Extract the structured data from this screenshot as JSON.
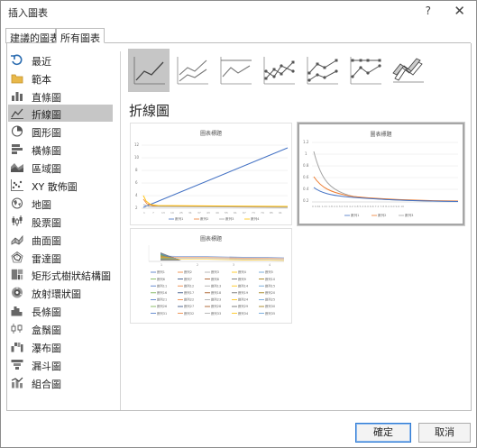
{
  "dialog": {
    "title": "插入圖表",
    "help": "?",
    "close": "✕"
  },
  "tabs": [
    {
      "label": "建議的圖表",
      "active": false
    },
    {
      "label": "所有圖表",
      "active": true
    }
  ],
  "sidebar": {
    "items": [
      {
        "label": "最近",
        "icon": "recent-icon"
      },
      {
        "label": "範本",
        "icon": "template-folder-icon"
      },
      {
        "label": "直條圖",
        "icon": "column-chart-icon"
      },
      {
        "label": "折線圖",
        "icon": "line-chart-icon",
        "selected": true
      },
      {
        "label": "圓形圖",
        "icon": "pie-chart-icon"
      },
      {
        "label": "橫條圖",
        "icon": "bar-chart-icon"
      },
      {
        "label": "區域圖",
        "icon": "area-chart-icon"
      },
      {
        "label": "XY 散佈圖",
        "icon": "scatter-chart-icon"
      },
      {
        "label": "地圖",
        "icon": "map-chart-icon"
      },
      {
        "label": "股票圖",
        "icon": "stock-chart-icon"
      },
      {
        "label": "曲面圖",
        "icon": "surface-chart-icon"
      },
      {
        "label": "雷達圖",
        "icon": "radar-chart-icon"
      },
      {
        "label": "矩形式樹狀結構圖",
        "icon": "treemap-chart-icon"
      },
      {
        "label": "放射環狀圖",
        "icon": "sunburst-chart-icon"
      },
      {
        "label": "長條圖",
        "icon": "histogram-chart-icon"
      },
      {
        "label": "盒鬚圖",
        "icon": "box-whisker-chart-icon"
      },
      {
        "label": "瀑布圖",
        "icon": "waterfall-chart-icon"
      },
      {
        "label": "漏斗圖",
        "icon": "funnel-chart-icon"
      },
      {
        "label": "組合圖",
        "icon": "combo-chart-icon"
      }
    ]
  },
  "subtypes": [
    {
      "name": "line-subtype",
      "selected": true
    },
    {
      "name": "stacked-line-subtype"
    },
    {
      "name": "percent-stacked-line-subtype"
    },
    {
      "name": "line-markers-subtype"
    },
    {
      "name": "stacked-line-markers-subtype"
    },
    {
      "name": "percent-stacked-line-markers-subtype"
    },
    {
      "name": "3d-line-subtype"
    }
  ],
  "section_title": "折線圖",
  "previews": {
    "p1": {
      "title": "圖表標題",
      "y_ticks": [
        "12",
        "10",
        "8",
        "6",
        "4",
        "2",
        "0"
      ],
      "legend": [
        "數列1",
        "數列2",
        "數列3",
        "數列4"
      ],
      "colors": [
        "#4472c4",
        "#ed7d31",
        "#a5a5a5",
        "#ffc000"
      ]
    },
    "p2": {
      "title": "圖表標題",
      "y_ticks": [
        "1.2",
        "1",
        "0.8",
        "0.6",
        "0.4",
        "0.2",
        "0"
      ],
      "x_axis_text": "0  0.61  1.21  1.8  2.4  3.0  3.6  4.2  4.8  5.4  6.0  6.6  7.2  7.8  8.4  9.0  9.6  10",
      "legend": [
        "數列1",
        "數列2",
        "數列3"
      ],
      "colors": [
        "#4472c4",
        "#ed7d31",
        "#a5a5a5"
      ]
    },
    "p3": {
      "title": "圖表標題",
      "x_ticks": [
        "1",
        "2",
        "3",
        "4"
      ],
      "legend_rows": [
        [
          "數列1",
          "數列2",
          "數列3",
          "數列4",
          "數列5"
        ],
        [
          "數列6",
          "數列7",
          "數列8",
          "數列9",
          "數列10"
        ],
        [
          "數列11",
          "數列12",
          "數列13",
          "數列14",
          "數列15"
        ],
        [
          "數列16",
          "數列17",
          "數列18",
          "數列19",
          "數列20"
        ],
        [
          "數列21",
          "數列22",
          "數列23",
          "數列24",
          "數列25"
        ],
        [
          "數列26",
          "數列27",
          "數列28",
          "數列29",
          "數列30"
        ],
        [
          "數列31",
          "數列32",
          "數列33",
          "數列34",
          "數列35"
        ]
      ]
    }
  },
  "buttons": {
    "ok": "確定",
    "cancel": "取消"
  },
  "accent": "#2f7bd4"
}
